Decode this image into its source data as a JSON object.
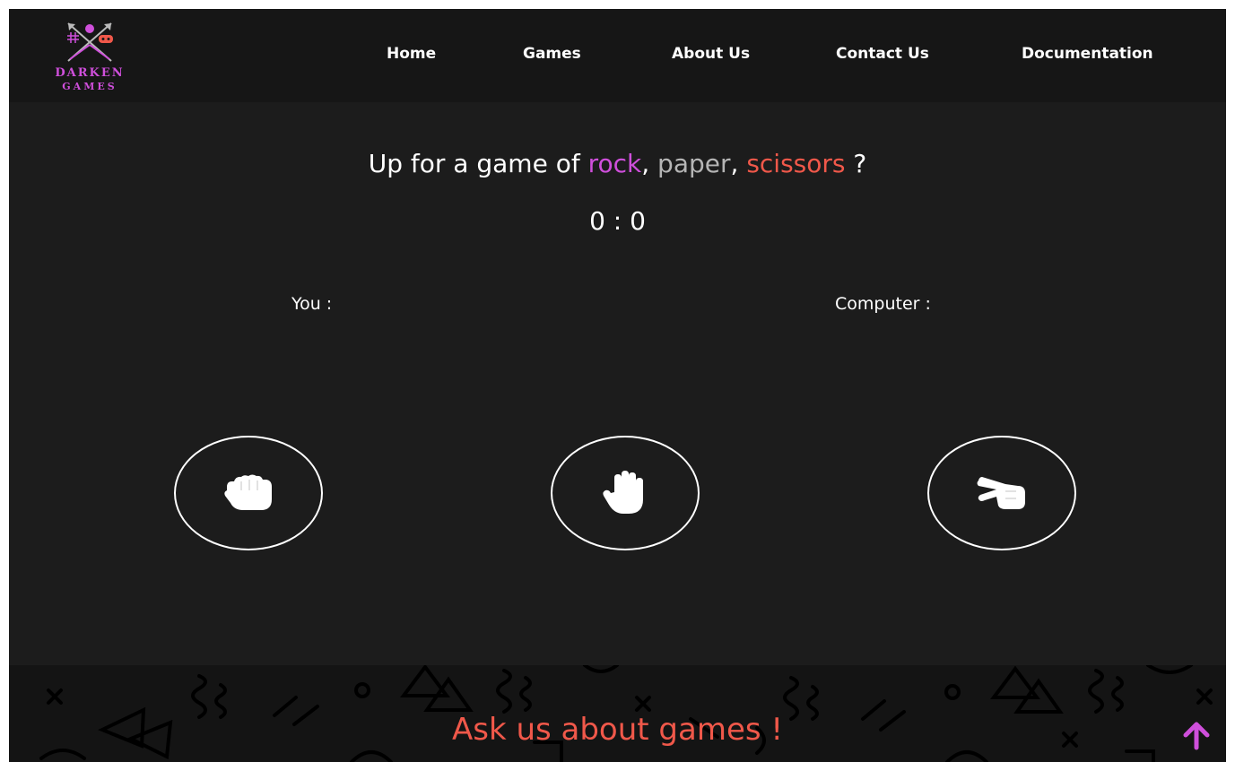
{
  "brand": {
    "line1": "DARKEN",
    "line2": "GAMES",
    "color": "#cf4fdb"
  },
  "nav": {
    "items": [
      "Home",
      "Games",
      "About Us",
      "Contact Us",
      "Documentation"
    ]
  },
  "headline": {
    "prefix": "Up for a game of ",
    "word1": "rock",
    "sep1": ", ",
    "word2": "paper",
    "sep2": ", ",
    "word3": "scissors",
    "suffix": " ?"
  },
  "score": "0 : 0",
  "players": {
    "you_label": "You :",
    "computer_label": "Computer :"
  },
  "choices": {
    "icons": [
      "hand-rock-icon",
      "hand-paper-icon",
      "hand-scissors-icon"
    ]
  },
  "footer": {
    "text": "Ask us about games !",
    "scroll_icon": "arrow-up-icon"
  },
  "colors": {
    "background": "#1c1c1c",
    "header": "#161616",
    "accent_pink": "#cf4fdb",
    "accent_gray": "#b5b5b5",
    "accent_red": "#f0584a",
    "text": "#ffffff"
  }
}
